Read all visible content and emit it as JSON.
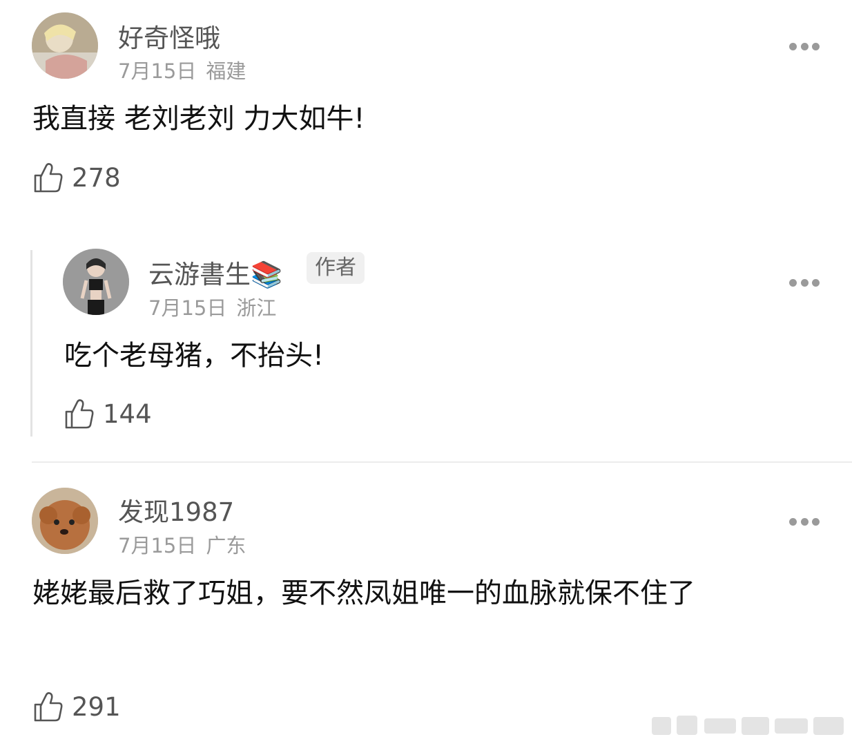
{
  "comments": [
    {
      "username": "好奇怪哦",
      "date": "7月15日",
      "location": "福建",
      "text": "我直接 老刘老刘 力大如牛!",
      "likes": "278",
      "avatar_icon": "user-photo-avatar"
    },
    {
      "username": "云游書生📚",
      "badge": "作者",
      "date": "7月15日",
      "location": "浙江",
      "text": "吃个老母猪，不抬头!",
      "likes": "144",
      "avatar_icon": "user-photo-avatar"
    },
    {
      "username": "发现1987",
      "date": "7月15日",
      "location": "广东",
      "text": "姥姥最后救了巧姐，要不然凤姐唯一的血脉就保不住了",
      "likes": "291",
      "avatar_icon": "dog-photo-avatar"
    }
  ],
  "icons": {
    "like": "thumbs-up-icon",
    "more": "more-dots-icon"
  },
  "colors": {
    "username": "#555555",
    "meta": "#9a9a9a",
    "text": "#111111",
    "badge_bg": "#f0f0f0"
  }
}
